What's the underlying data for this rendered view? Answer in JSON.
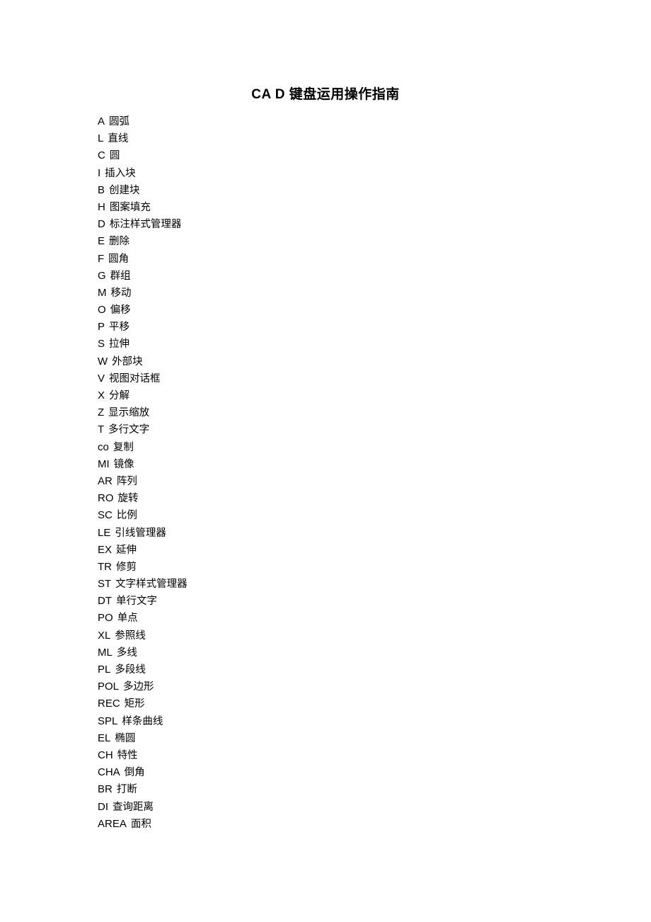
{
  "document": {
    "title": "CA D 键盘运用操作指南",
    "entries": [
      {
        "cmd": "A",
        "desc": "圆弧"
      },
      {
        "cmd": "L",
        "desc": "直线"
      },
      {
        "cmd": "C",
        "desc": "圆"
      },
      {
        "cmd": "I",
        "desc": "插入块"
      },
      {
        "cmd": "B",
        "desc": "创建块"
      },
      {
        "cmd": "H",
        "desc": "图案填充"
      },
      {
        "cmd": "D",
        "desc": "标注样式管理器"
      },
      {
        "cmd": "E",
        "desc": "删除"
      },
      {
        "cmd": "F",
        "desc": "圆角"
      },
      {
        "cmd": "G",
        "desc": "群组"
      },
      {
        "cmd": "M",
        "desc": "移动"
      },
      {
        "cmd": "O",
        "desc": "偏移"
      },
      {
        "cmd": "P",
        "desc": "平移"
      },
      {
        "cmd": "S",
        "desc": "拉伸"
      },
      {
        "cmd": "W",
        "desc": "外部块"
      },
      {
        "cmd": "V",
        "desc": "视图对话框"
      },
      {
        "cmd": "X",
        "desc": "分解"
      },
      {
        "cmd": "Z",
        "desc": "显示缩放"
      },
      {
        "cmd": "T",
        "desc": "多行文字"
      },
      {
        "cmd": "co",
        "desc": "复制"
      },
      {
        "cmd": "MI",
        "desc": "镜像"
      },
      {
        "cmd": "AR",
        "desc": "阵列"
      },
      {
        "cmd": "RO",
        "desc": "旋转"
      },
      {
        "cmd": "SC",
        "desc": "比例"
      },
      {
        "cmd": "LE",
        "desc": "引线管理器"
      },
      {
        "cmd": "EX",
        "desc": "延伸"
      },
      {
        "cmd": "TR",
        "desc": "修剪"
      },
      {
        "cmd": "ST",
        "desc": "文字样式管理器"
      },
      {
        "cmd": "DT",
        "desc": "单行文字"
      },
      {
        "cmd": "PO",
        "desc": "单点"
      },
      {
        "cmd": "XL",
        "desc": "参照线"
      },
      {
        "cmd": "ML",
        "desc": "多线"
      },
      {
        "cmd": "PL",
        "desc": "多段线"
      },
      {
        "cmd": "POL",
        "desc": "多边形"
      },
      {
        "cmd": "REC",
        "desc": "矩形"
      },
      {
        "cmd": "SPL",
        "desc": "样条曲线"
      },
      {
        "cmd": "EL",
        "desc": "椭圆"
      },
      {
        "cmd": "CH",
        "desc": "特性"
      },
      {
        "cmd": "CHA",
        "desc": "倒角"
      },
      {
        "cmd": "BR",
        "desc": "打断"
      },
      {
        "cmd": "DI",
        "desc": "查询距离"
      },
      {
        "cmd": "AREA",
        "desc": "面积"
      }
    ]
  }
}
